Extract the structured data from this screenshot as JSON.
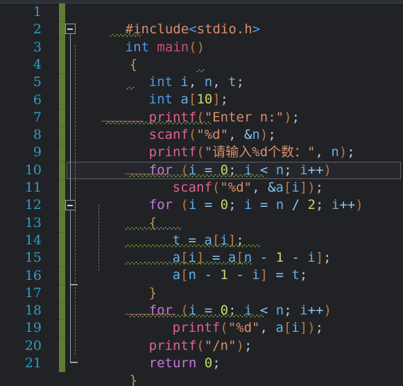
{
  "app": {
    "kind": "code-editor",
    "language": "C",
    "theme": "dark",
    "total_lines": 21,
    "caret_line": 10
  },
  "colors": {
    "background": "#212226",
    "top_strip": "#2d3036",
    "line_number": "#2f9ec4",
    "vcs_change_bar": "#5f7d35",
    "caret_line_border": "#5d6066",
    "caret_line_bg": "#26272c",
    "fold_marker": "#9aa0a6",
    "indent_guide": "#6e7176",
    "squiggle_warning": "#6f9a3a",
    "keyword": "#4e9ae6",
    "control_keyword": "#c678dd",
    "function_name": "#cf4f6e",
    "string": "#d98f6a",
    "number": "#c3d96a",
    "variable": "#62b0e8",
    "bracket": "#b9783f",
    "operator": "#8fc7f0",
    "brace": "#c09553",
    "preprocessor": "#d98f6a"
  },
  "gutter": {
    "line_numbers": [
      "1",
      "2",
      "3",
      "4",
      "5",
      "6",
      "7",
      "8",
      "9",
      "10",
      "11",
      "12",
      "13",
      "14",
      "15",
      "16",
      "17",
      "18",
      "19",
      "20",
      "21"
    ]
  },
  "fold_markers": [
    {
      "line": 2,
      "state": "expanded",
      "icon": "fold-minus-icon"
    },
    {
      "line": 11,
      "state": "expanded",
      "icon": "fold-minus-icon"
    }
  ],
  "code": {
    "lines": [
      {
        "n": 1,
        "indent": 0,
        "text": "#include<stdio.h>"
      },
      {
        "n": 2,
        "indent": 0,
        "text": "int main()"
      },
      {
        "n": 3,
        "indent": 0,
        "text": "{"
      },
      {
        "n": 4,
        "indent": 1,
        "text": "int i, n, t;"
      },
      {
        "n": 5,
        "indent": 1,
        "text": "int a[10];"
      },
      {
        "n": 6,
        "indent": 1,
        "text": "printf(\"Enter n:\");"
      },
      {
        "n": 7,
        "indent": 1,
        "text": "scanf(\"%d\", &n);"
      },
      {
        "n": 8,
        "indent": 1,
        "text": "printf(\"请输入%d个数：\", n);"
      },
      {
        "n": 9,
        "indent": 1,
        "text": "for (i = 0; i < n; i++)"
      },
      {
        "n": 10,
        "indent": 2,
        "text": "scanf(\"%d\", &a[i]);"
      },
      {
        "n": 11,
        "indent": 1,
        "text": "for (i = 0; i = n / 2; i++)"
      },
      {
        "n": 12,
        "indent": 1,
        "text": "{"
      },
      {
        "n": 13,
        "indent": 2,
        "text": "t = a[i];"
      },
      {
        "n": 14,
        "indent": 2,
        "text": "a[i] = a[n - 1 - i];"
      },
      {
        "n": 15,
        "indent": 2,
        "text": "a[n - 1 - i] = t;"
      },
      {
        "n": 16,
        "indent": 1,
        "text": "}"
      },
      {
        "n": 17,
        "indent": 1,
        "text": "for (i = 0; i < n; i++)"
      },
      {
        "n": 18,
        "indent": 2,
        "text": "printf(\"%d\", a[i]);"
      },
      {
        "n": 19,
        "indent": 1,
        "text": "printf(\"/n\");"
      },
      {
        "n": 20,
        "indent": 1,
        "text": "return 0;"
      },
      {
        "n": 21,
        "indent": 0,
        "text": "}"
      }
    ],
    "line1": {
      "hash_include": "#include",
      "lt": "<",
      "header": "stdio.h",
      "gt": ">"
    },
    "line2": {
      "kw": "int",
      "fn": "main",
      "parens": "()"
    },
    "line3": {
      "brace": "{"
    },
    "line4": {
      "kw": "int",
      "v1": "i",
      "c1": ", ",
      "v2": "n",
      "c2": ", ",
      "v3": "t",
      "semi": ";"
    },
    "line5": {
      "kw": "int",
      "v": "a",
      "lb": "[",
      "num": "10",
      "rb": "]",
      "semi": ";"
    },
    "line6": {
      "fn": "printf",
      "lp": "(",
      "str": "\"Enter n:\"",
      "rp": ")",
      "semi": ";"
    },
    "line7": {
      "fn": "scanf",
      "lp": "(",
      "str": "\"%d\"",
      "comma": ", ",
      "amp": "&",
      "v": "n",
      "rp": ")",
      "semi": ";"
    },
    "line8": {
      "fn": "printf",
      "lp": "(",
      "str": "\"请输入%d个数：\"",
      "comma": ", ",
      "v": "n",
      "rp": ")",
      "semi": ";"
    },
    "line9": {
      "ctrl": "for",
      "lp": " (",
      "v1": "i",
      "eq": " = ",
      "num": "0",
      "s1": "; ",
      "v2": "i",
      "lt": " < ",
      "v3": "n",
      "s2": "; ",
      "v4": "i",
      "inc": "++",
      "rp": ")"
    },
    "line10": {
      "fn": "scanf",
      "lp": "(",
      "str": "\"%d\"",
      "comma": ", ",
      "amp": "&",
      "v": "a",
      "lb": "[",
      "idx": "i",
      "rb": "]",
      "rp": ")",
      "semi": ";"
    },
    "line11": {
      "ctrl": "for",
      "lp": " (",
      "v1": "i",
      "eq": " = ",
      "num": "0",
      "s1": "; ",
      "v2": "i",
      "eq2": " = ",
      "v3": "n",
      "div": " / ",
      "num2": "2",
      "s2": "; ",
      "v4": "i",
      "inc": "++",
      "rp": ")"
    },
    "line12": {
      "brace": "{"
    },
    "line13": {
      "v1": "t",
      "eq": " = ",
      "v2": "a",
      "lb": "[",
      "idx": "i",
      "rb": "]",
      "semi": ";"
    },
    "line14": {
      "v1": "a",
      "lb1": "[",
      "i1": "i",
      "rb1": "]",
      "eq": " = ",
      "v2": "a",
      "lb2": "[",
      "n": "n",
      "m1": " - ",
      "one": "1",
      "m2": " - ",
      "i2": "i",
      "rb2": "]",
      "semi": ";"
    },
    "line15": {
      "v1": "a",
      "lb": "[",
      "n": "n",
      "m1": " - ",
      "one": "1",
      "m2": " - ",
      "i": "i",
      "rb": "]",
      "eq": " = ",
      "t": "t",
      "semi": ";"
    },
    "line16": {
      "brace": "}"
    },
    "line17": {
      "ctrl": "for",
      "lp": " (",
      "v1": "i",
      "eq": " = ",
      "num": "0",
      "s1": "; ",
      "v2": "i",
      "lt": " < ",
      "v3": "n",
      "s2": "; ",
      "v4": "i",
      "inc": "++",
      "rp": ")"
    },
    "line18": {
      "fn": "printf",
      "lp": "(",
      "str": "\"%d\"",
      "comma": ", ",
      "v": "a",
      "lb": "[",
      "idx": "i",
      "rb": "]",
      "rp": ")",
      "semi": ";"
    },
    "line19": {
      "fn": "printf",
      "lp": "(",
      "str": "\"/n\"",
      "rp": ")",
      "semi": ";"
    },
    "line20": {
      "ctrl": "return",
      "sp": " ",
      "num": "0",
      "semi": ";"
    },
    "line21": {
      "brace": "}"
    }
  },
  "warnings": {
    "squiggle_lines": [
      2,
      4,
      5,
      7,
      10,
      13,
      14,
      15,
      18
    ],
    "description": "green wavy underline markers"
  }
}
